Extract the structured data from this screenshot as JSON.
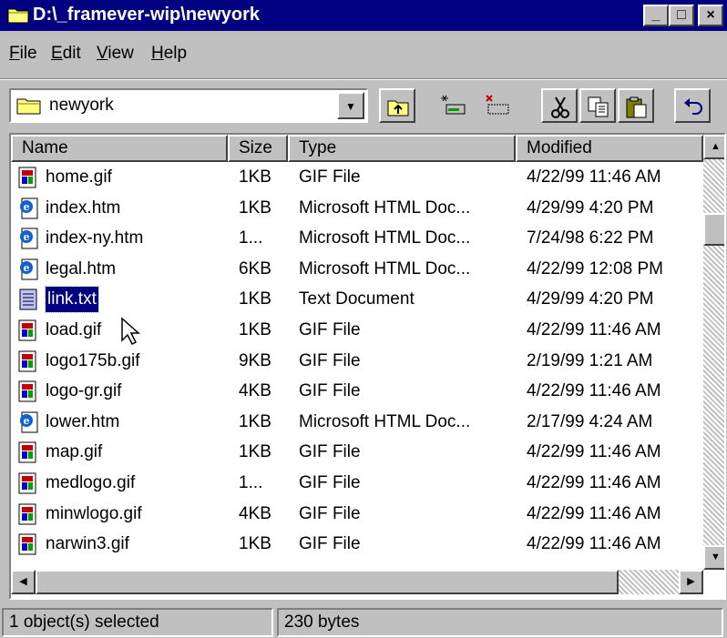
{
  "window": {
    "title": "D:\\_framever-wip\\newyork",
    "controls": {
      "minimize": "_",
      "maximize": "□",
      "close": "×"
    }
  },
  "menu": [
    {
      "label": "File",
      "accel": "F",
      "rest": "ile"
    },
    {
      "label": "Edit",
      "accel": "E",
      "rest": "dit"
    },
    {
      "label": "View",
      "accel": "V",
      "rest": "iew"
    },
    {
      "label": "Help",
      "accel": "H",
      "rest": "elp"
    }
  ],
  "toolbar": {
    "address": "newyork",
    "address_icon": "folder-icon",
    "tools": [
      "up-folder-icon",
      "map-drive-icon",
      "disconnect-drive-icon",
      "cut-icon",
      "copy-icon",
      "paste-icon",
      "undo-icon"
    ]
  },
  "columns": {
    "name": "Name",
    "size": "Size",
    "type": "Type",
    "modified": "Modified"
  },
  "files": [
    {
      "name": "home.gif",
      "size": "1KB",
      "type": "GIF File",
      "modified": "4/22/99 11:46 AM",
      "icon": "gif",
      "selected": false
    },
    {
      "name": "index.htm",
      "size": "1KB",
      "type": "Microsoft HTML Doc...",
      "modified": "4/29/99 4:20 PM",
      "icon": "htm",
      "selected": false
    },
    {
      "name": "index-ny.htm",
      "size": "1...",
      "type": "Microsoft HTML Doc...",
      "modified": "7/24/98 6:22 PM",
      "icon": "htm",
      "selected": false
    },
    {
      "name": "legal.htm",
      "size": "6KB",
      "type": "Microsoft HTML Doc...",
      "modified": "4/22/99 12:08 PM",
      "icon": "htm",
      "selected": false
    },
    {
      "name": "link.txt",
      "size": "1KB",
      "type": "Text Document",
      "modified": "4/29/99 4:20 PM",
      "icon": "txt",
      "selected": true
    },
    {
      "name": "load.gif",
      "size": "1KB",
      "type": "GIF File",
      "modified": "4/22/99 11:46 AM",
      "icon": "gif",
      "selected": false
    },
    {
      "name": "logo175b.gif",
      "size": "9KB",
      "type": "GIF File",
      "modified": "2/19/99 1:21 AM",
      "icon": "gif",
      "selected": false
    },
    {
      "name": "logo-gr.gif",
      "size": "4KB",
      "type": "GIF File",
      "modified": "4/22/99 11:46 AM",
      "icon": "gif",
      "selected": false
    },
    {
      "name": "lower.htm",
      "size": "1KB",
      "type": "Microsoft HTML Doc...",
      "modified": "2/17/99 4:24 AM",
      "icon": "htm",
      "selected": false
    },
    {
      "name": "map.gif",
      "size": "1KB",
      "type": "GIF File",
      "modified": "4/22/99 11:46 AM",
      "icon": "gif",
      "selected": false
    },
    {
      "name": "medlogo.gif",
      "size": "1...",
      "type": "GIF File",
      "modified": "4/22/99 11:46 AM",
      "icon": "gif",
      "selected": false
    },
    {
      "name": "minwlogo.gif",
      "size": "4KB",
      "type": "GIF File",
      "modified": "4/22/99 11:46 AM",
      "icon": "gif",
      "selected": false
    },
    {
      "name": "narwin3.gif",
      "size": "1KB",
      "type": "GIF File",
      "modified": "4/22/99 11:46 AM",
      "icon": "gif",
      "selected": false
    }
  ],
  "status": {
    "selection": "1 object(s) selected",
    "size": "230 bytes"
  },
  "colors": {
    "titlebar": "#000080",
    "selection": "#000080",
    "face": "#c0c0c0"
  }
}
